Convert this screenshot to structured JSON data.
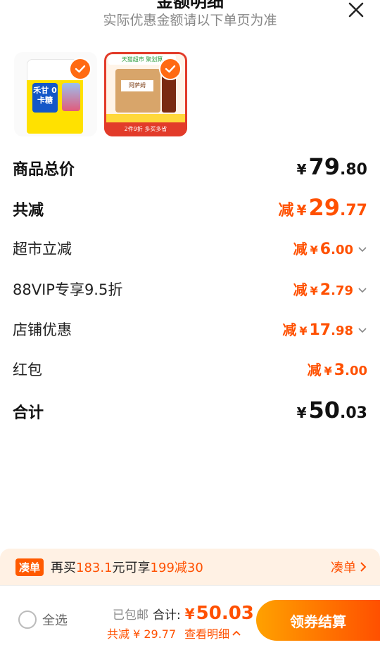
{
  "header": {
    "title": "金额明细",
    "subtitle": "实际优惠金额请以下单页为准"
  },
  "summary": {
    "total_label": "商品总价",
    "total_int": "79",
    "total_dec": ".80",
    "reduce_label": "共减",
    "reduce_prefix": "减",
    "reduce_int": "29",
    "reduce_dec": ".77",
    "sum_label": "合计",
    "sum_int": "50",
    "sum_dec": ".03",
    "yen": "¥"
  },
  "discounts": [
    {
      "label": "超市立减",
      "prefix": "减",
      "int": "6",
      "dec": ".00"
    },
    {
      "label": "88VIP专享9.5折",
      "prefix": "减",
      "int": "2",
      "dec": ".79"
    },
    {
      "label": "店铺优惠",
      "prefix": "减",
      "int": "17",
      "dec": ".98"
    },
    {
      "label": "红包",
      "prefix": "减",
      "int": "3",
      "dec": ".00"
    }
  ],
  "products": [
    {
      "name_text": "禾甘 0卡糖"
    },
    {
      "top_text": "天猫超市 聚划算",
      "band_text": "2件9折 多买多省",
      "box_label": "阿萨姆"
    }
  ],
  "promo": {
    "tag": "凑单",
    "text_a": "再买",
    "amount": "183.1",
    "text_b": "元可享",
    "deal": "199减30",
    "link": "凑单"
  },
  "footer": {
    "select_all": "全选",
    "free_shipping": "已包邮",
    "sum_label": "合计:",
    "yen": "¥",
    "sum_value": "50.03",
    "reduce_text": "共减 ¥ 29.77",
    "detail_link": "查看明细",
    "checkout": "领券结算"
  },
  "colors": {
    "accent": "#ff5000",
    "promo_bg": "#fff1e4"
  }
}
